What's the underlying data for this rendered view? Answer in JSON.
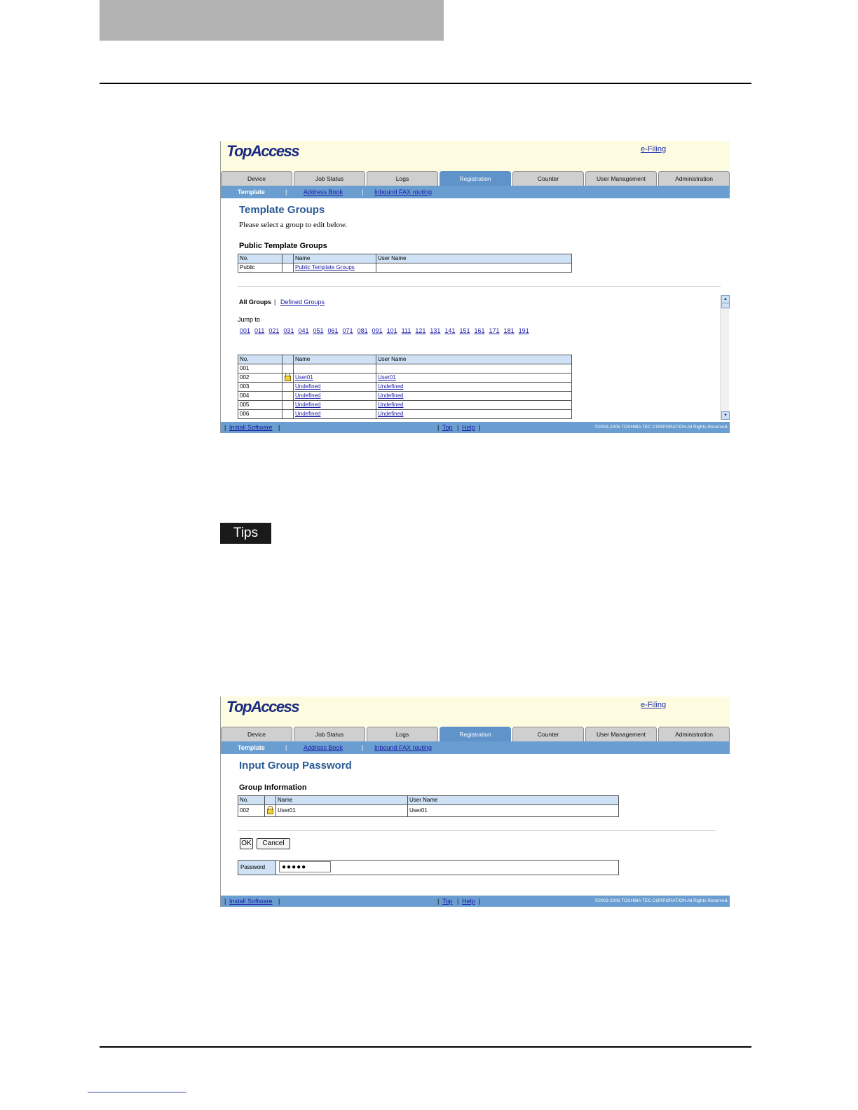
{
  "shot1": {
    "logo": "TopAccess",
    "efiling_link": "e-Filing",
    "tabs": [
      {
        "label": "Device"
      },
      {
        "label": "Job Status"
      },
      {
        "label": "Logs"
      },
      {
        "label": "Registration"
      },
      {
        "label": "Counter"
      },
      {
        "label": "User Management"
      },
      {
        "label": "Administration"
      }
    ],
    "subnav": {
      "current": "Template",
      "sep": "|",
      "address_book": "Address Book",
      "inbound_fax": "Inbound FAX routing"
    },
    "title": "Template Groups",
    "intro": "Please select a group to edit below.",
    "public_section": {
      "heading": "Public Template Groups",
      "headers": {
        "no": "No.",
        "name": "Name",
        "user": "User Name"
      },
      "row": {
        "no": "Public",
        "name": "Public Template Groups",
        "user": ""
      }
    },
    "filter": {
      "all": "All Groups",
      "sep": "|",
      "defined": "Defined Groups"
    },
    "jump_label": "Jump to",
    "jump_links": [
      "001",
      "011",
      "021",
      "031",
      "041",
      "051",
      "061",
      "071",
      "081",
      "091",
      "101",
      "111",
      "121",
      "131",
      "141",
      "151",
      "161",
      "171",
      "181",
      "191"
    ],
    "groups_table": {
      "headers": {
        "no": "No.",
        "name": "Name",
        "user": "User Name"
      },
      "rows": [
        {
          "no": "001",
          "name": "",
          "user": ""
        },
        {
          "no": "002",
          "name": "User01",
          "user": "User01"
        },
        {
          "no": "003",
          "name": "Undefined",
          "user": "Undefined"
        },
        {
          "no": "004",
          "name": "Undefined",
          "user": "Undefined"
        },
        {
          "no": "005",
          "name": "Undefined",
          "user": "Undefined"
        },
        {
          "no": "006",
          "name": "Undefined",
          "user": "Undefined"
        }
      ]
    },
    "footer": {
      "install": "Install Software",
      "top": "Top",
      "help": "Help",
      "bar": "|",
      "copyright": "©2003-2006 TOSHIBA TEC CORPORATION All Rights Reserved."
    }
  },
  "tips_label": "Tips",
  "shot2": {
    "logo": "TopAccess",
    "efiling_link": "e-Filing",
    "tabs": [
      {
        "label": "Device"
      },
      {
        "label": "Job Status"
      },
      {
        "label": "Logs"
      },
      {
        "label": "Registration"
      },
      {
        "label": "Counter"
      },
      {
        "label": "User Management"
      },
      {
        "label": "Administration"
      }
    ],
    "subnav": {
      "current": "Template",
      "sep": "|",
      "address_book": "Address Book",
      "inbound_fax": "Inbound FAX routing"
    },
    "title": "Input Group Password",
    "group_info": {
      "heading": "Group Information",
      "headers": {
        "no": "No.",
        "name": "Name",
        "user": "User Name"
      },
      "row": {
        "no": "002",
        "name": "User01",
        "user": "User01"
      }
    },
    "ok_button": "OK",
    "cancel_button": "Cancel",
    "password_label": "Password",
    "password_value": "●●●●●",
    "footer": {
      "install": "Install Software",
      "top": "Top",
      "help": "Help",
      "bar": "|",
      "copyright": "©2003-2006 TOSHIBA TEC CORPORATION All Rights Reserved."
    }
  }
}
